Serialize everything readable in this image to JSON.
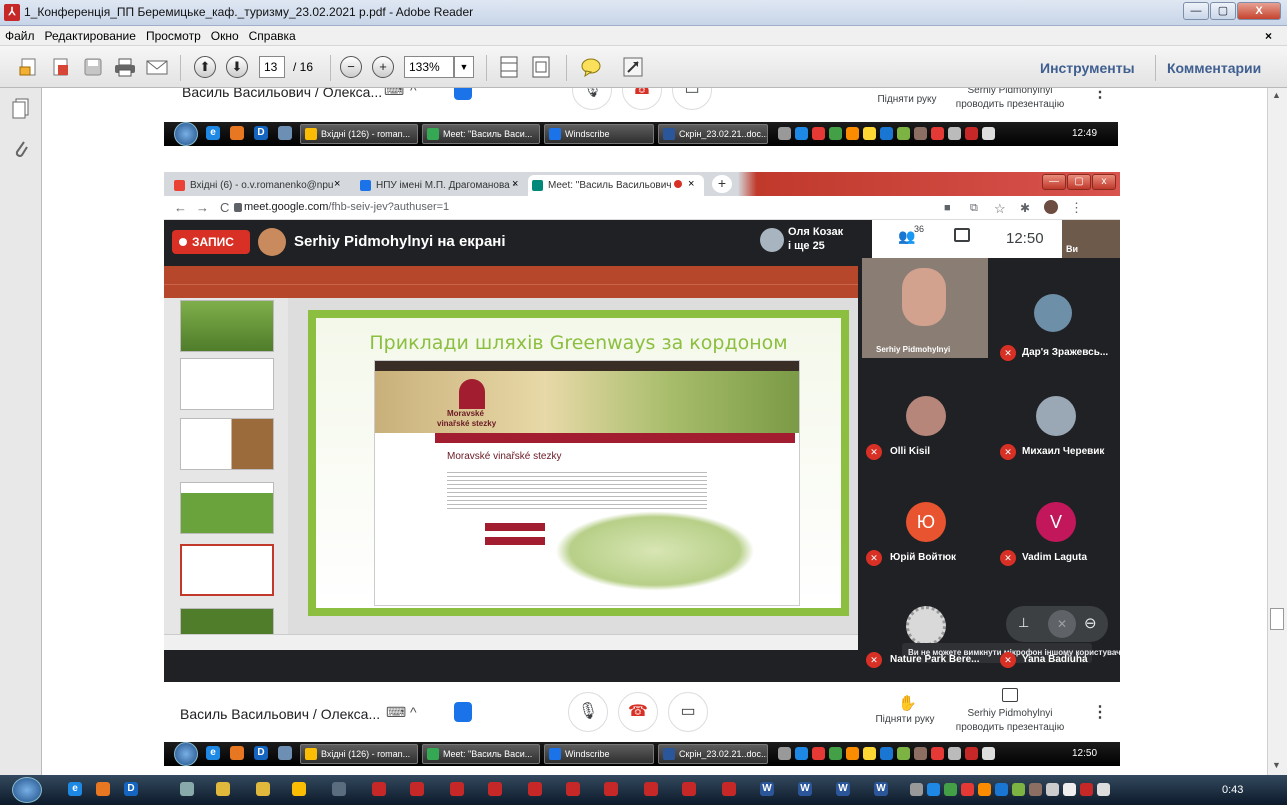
{
  "window": {
    "title": "1_Конференція_ПП Беремицьке_каф._туризму_23.02.2021 р.pdf - Adobe Reader",
    "controls": {
      "minimize": "—",
      "maximize": "▢",
      "close": "X"
    }
  },
  "menu": {
    "items": [
      "Файл",
      "Редактирование",
      "Просмотр",
      "Окно",
      "Справка"
    ],
    "close": "×"
  },
  "toolbar": {
    "page_current": "13",
    "page_total": "/ 16",
    "zoom": "133%",
    "tools_label": "Инструменты",
    "comments_label": "Комментарии"
  },
  "meet_top": {
    "presenter_name": "Василь Васильович / Олекса...",
    "raise_hand": "Підняти руку",
    "presenting_line1": "Serhiy Pidmohylnyi",
    "presenting_line2": "проводить презентацію"
  },
  "taskbar_top": {
    "tasks": [
      "Вхідні (126) - roman...",
      "Meet: \"Василь Васи...",
      "Windscribe",
      "Скрін_23.02.21..doc..."
    ],
    "clock": "12:49"
  },
  "chrome": {
    "tabs": [
      "Вхідні (6) - o.v.romanenko@npu",
      "НПУ імені М.П. Драгоманова -",
      "Meet: \"Василь Васильович"
    ],
    "tab_close": "×",
    "new_tab": "+",
    "url_host": "meet.google.com",
    "url_path": "/fhb-seiv-jev?authuser=1"
  },
  "meet": {
    "record_label": "ЗАПИС",
    "presenting_label": "Serhiy Pidmohylnyi на екрані",
    "people_top_name": "Оля Козак",
    "people_top_more": "і ще 25",
    "participant_count": "36",
    "clock": "12:50",
    "self_label": "Ви",
    "tooltip": "Ви не можете вимкнути мікрофон іншому користувачу",
    "participants": [
      {
        "name": "Serhiy Pidmohylnyi",
        "initial": "",
        "color": "#8a7d74"
      },
      {
        "name": "Дар'я Зражевсь...",
        "initial": "",
        "color": "#6e8fa8"
      },
      {
        "name": "Olli Kisil",
        "initial": "",
        "color": "#b7867a"
      },
      {
        "name": "Михаил Черевик",
        "initial": "",
        "color": "#9aa7b5"
      },
      {
        "name": "Юрій Войтюк",
        "initial": "Ю",
        "color": "#e8542f"
      },
      {
        "name": "Vadim Laguta",
        "initial": "V",
        "color": "#c2185b"
      },
      {
        "name": "Nature Park Bere...",
        "initial": "",
        "color": "#d9d9d9"
      },
      {
        "name": "Yana Badiuha",
        "initial": "",
        "color": "#555"
      }
    ]
  },
  "slide": {
    "title": "Приклади шляхів Greenways за кордоном",
    "site_logo_line1": "Moravské",
    "site_logo_line2": "vinařské stezky",
    "site_heading": "Moravské vinařské stezky"
  },
  "meet_bottom": {
    "presenter_name": "Василь Васильович / Олекса...",
    "raise_hand": "Підняти руку",
    "presenting_line1": "Serhiy Pidmohylnyi",
    "presenting_line2": "проводить презентацію"
  },
  "taskbar_bottom": {
    "tasks": [
      "Вхідні (126) - roman...",
      "Meet: \"Василь Васи...",
      "Windscribe",
      "Скрін_23.02.21..doc..."
    ],
    "clock": "12:50"
  },
  "os_taskbar": {
    "clock": "0:43"
  },
  "colors": {
    "meet_red": "#d93025",
    "meet_dark": "#202124",
    "slide_green": "#8cbf3f",
    "acrobat_link": "#3f5f91"
  }
}
